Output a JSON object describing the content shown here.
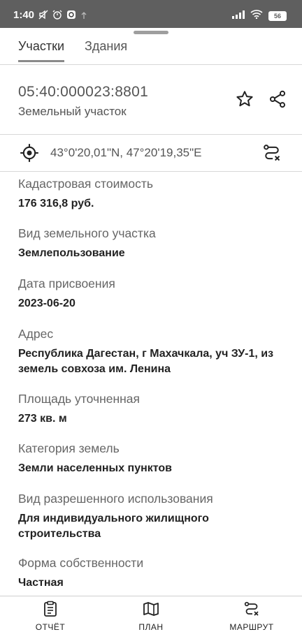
{
  "status_bar": {
    "time": "1:40",
    "battery": "56"
  },
  "tabs": [
    {
      "label": "Участки"
    },
    {
      "label": "Здания"
    }
  ],
  "parcel": {
    "cadastral_number": "05:40:000023:8801",
    "type": "Земельный участок",
    "coordinates": "43°0'20,01\"N, 47°20'19,35\"E"
  },
  "fields": [
    {
      "label": "Кадастровая стоимость",
      "value": "176 316,8 руб."
    },
    {
      "label": "Вид земельного участка",
      "value": "Землепользование"
    },
    {
      "label": "Дата присвоения",
      "value": "2023-06-20"
    },
    {
      "label": "Адрес",
      "value_lines": [
        "Республика Дагестан, г Махачкала, уч ЗУ-1, из",
        "земель совхоза им. Ленина"
      ]
    },
    {
      "label": "Площадь уточненная",
      "value": "273 кв. м"
    },
    {
      "label": "Категория земель",
      "value": "Земли населенных пунктов"
    },
    {
      "label": "Вид разрешенного использования",
      "value_lines": [
        "Для индивидуального жилищного",
        "строительства"
      ]
    },
    {
      "label": "Форма собственности",
      "value": "Частная"
    }
  ],
  "bottom_nav": [
    {
      "label": "ОТЧЁТ",
      "icon": "report-icon"
    },
    {
      "label": "ПЛАН",
      "icon": "map-icon"
    },
    {
      "label": "МАРШРУТ",
      "icon": "route-icon"
    }
  ]
}
